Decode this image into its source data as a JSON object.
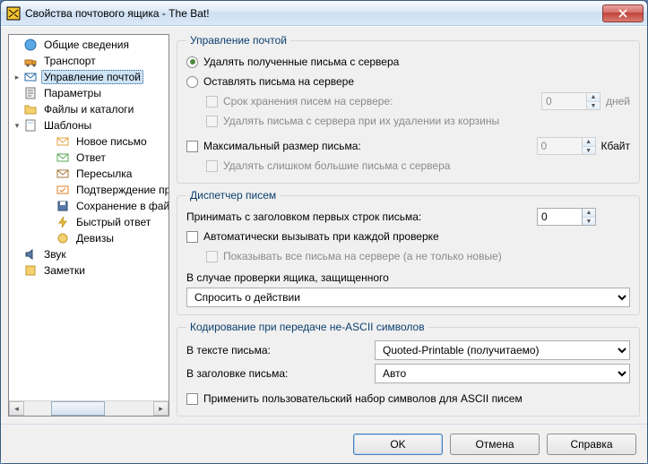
{
  "window": {
    "title": "Свойства почтового ящика - The Bat!"
  },
  "tree": {
    "root_label": "",
    "items": {
      "general": "Общие сведения",
      "transport": "Транспорт",
      "manage": "Управление почтой",
      "params": "Параметры",
      "files": "Файлы и каталоги",
      "templates": "Шаблоны",
      "tmpl_new": "Новое письмо",
      "tmpl_reply": "Ответ",
      "tmpl_fwd": "Пересылка",
      "tmpl_conf": "Подтверждение прочтения",
      "tmpl_save": "Сохранение в файл",
      "tmpl_quick": "Быстрый ответ",
      "tmpl_mot": "Девизы",
      "sound": "Звук",
      "notes": "Заметки"
    }
  },
  "mail": {
    "legend": "Управление почтой",
    "radio_delete": "Удалять полученные письма с сервера",
    "radio_keep": "Оставлять письма на сервере",
    "keep_days_label": "Срок хранения писем на сервере:",
    "keep_days_value": "0",
    "keep_days_unit": "дней",
    "delete_on_trash": "Удалять письма с сервера при их удалении из корзины",
    "max_size_label": "Максимальный размер письма:",
    "max_size_value": "0",
    "max_size_unit": "Кбайт",
    "del_too_big": "Удалять слишком большие письма с сервера"
  },
  "dispatcher": {
    "legend": "Диспетчер писем",
    "header_lines_label": "Принимать с заголовком первых строк письма:",
    "header_lines_value": "0",
    "auto_call": "Автоматически вызывать при каждой проверке",
    "show_all": "Показывать все письма на сервере (а не только новые)",
    "protected_label": "В случае проверки ящика, защищенного",
    "protected_options": [
      "Спросить о действии"
    ],
    "protected_selected": "Спросить о действии"
  },
  "encoding": {
    "legend": "Кодирование при передаче не-ASCII символов",
    "body_label": "В тексте письма:",
    "body_options": [
      "Quoted-Printable (получитаемо)"
    ],
    "body_selected": "Quoted-Printable (получитаемо)",
    "header_label": "В заголовке письма:",
    "header_options": [
      "Авто"
    ],
    "header_selected": "Авто",
    "custom_charset": "Применить пользовательский набор символов для ASCII писем"
  },
  "buttons": {
    "ok": "OK",
    "cancel": "Отмена",
    "help": "Справка"
  }
}
